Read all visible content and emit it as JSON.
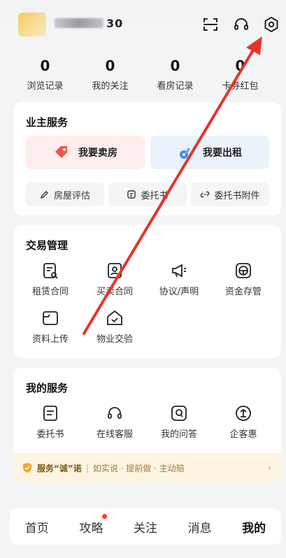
{
  "header": {
    "username_visible": "30",
    "scan_label": "scan-icon",
    "service_label": "headset-icon",
    "settings_label": "settings-icon"
  },
  "stats": [
    {
      "value": "0",
      "label": "浏览记录"
    },
    {
      "value": "0",
      "label": "我的关注"
    },
    {
      "value": "0",
      "label": "看房记录"
    },
    {
      "value": "0",
      "label": "卡券红包"
    }
  ],
  "owner_service": {
    "title": "业主服务",
    "sell_label": "我要卖房",
    "rent_label": "我要出租",
    "chips": [
      {
        "label": "房屋评估",
        "icon": "pen-icon"
      },
      {
        "label": "委托书",
        "icon": "document-icon"
      },
      {
        "label": "委托书附件",
        "icon": "link-icon"
      }
    ]
  },
  "trade": {
    "title": "交易管理",
    "items": [
      {
        "label": "租赁合同",
        "icon": "contract-search-icon"
      },
      {
        "label": "买卖合同",
        "icon": "contract-person-icon"
      },
      {
        "label": "协议/声明",
        "icon": "megaphone-icon"
      },
      {
        "label": "资金存管",
        "icon": "steering-icon"
      },
      {
        "label": "资料上传",
        "icon": "folder-icon"
      },
      {
        "label": "物业交验",
        "icon": "house-check-icon"
      }
    ]
  },
  "my_service": {
    "title": "我的服务",
    "items": [
      {
        "label": "委托书",
        "icon": "document-icon"
      },
      {
        "label": "在线客服",
        "icon": "headset-icon"
      },
      {
        "label": "我的问答",
        "icon": "question-icon"
      },
      {
        "label": "企客惠",
        "icon": "enterprise-icon"
      }
    ]
  },
  "promise": {
    "title": "服务“诚”诺",
    "description": "如实说 · 提前做 · 主动赔",
    "arrow": "›"
  },
  "tabs": [
    {
      "label": "首页",
      "active": false,
      "dot": false
    },
    {
      "label": "攻略",
      "active": false,
      "dot": true
    },
    {
      "label": "关注",
      "active": false,
      "dot": false
    },
    {
      "label": "消息",
      "active": false,
      "dot": false
    },
    {
      "label": "我的",
      "active": true,
      "dot": false
    }
  ],
  "colors": {
    "accent_red": "#e8332a",
    "sell_bg": "#fdeeed",
    "rent_bg": "#eaf2fc",
    "promise_bg": "#fdf4e1"
  }
}
